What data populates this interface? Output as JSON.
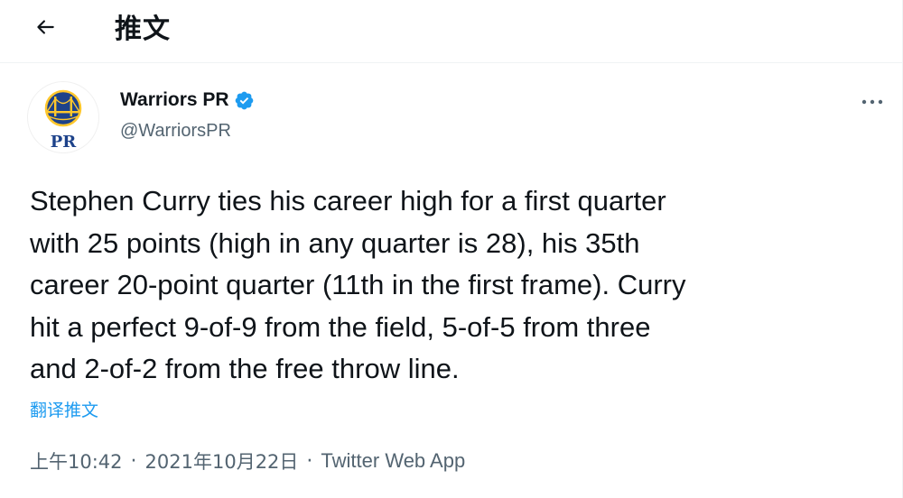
{
  "header": {
    "back_icon": "arrow-left-icon",
    "title": "推文"
  },
  "tweet": {
    "avatar": {
      "icon": "warriors-logo-icon",
      "badge_text": "PR",
      "colors": {
        "blue": "#1d428a",
        "gold": "#ffc72c"
      }
    },
    "display_name": "Warriors PR",
    "verified_icon": "verified-badge-icon",
    "handle": "@WarriorsPR",
    "more_icon": "more-horizontal-icon",
    "text": "Stephen Curry ties his career high for a first quarter\nwith 25 points (high in any quarter is 28), his 35th\ncareer 20-point quarter (11th in the first frame). Curry\nhit a perfect 9-of-9 from the field, 5-of-5 from three\nand 2-of-2 from the free throw line.",
    "translate_label": "翻译推文",
    "time": "上午10:42",
    "separator": "·",
    "date": "2021年10月22日",
    "source": "Twitter Web App"
  },
  "colors": {
    "accent": "#1d9bf0",
    "text_primary": "#0f1419",
    "text_secondary": "#536471",
    "divider": "#eff3f4"
  }
}
